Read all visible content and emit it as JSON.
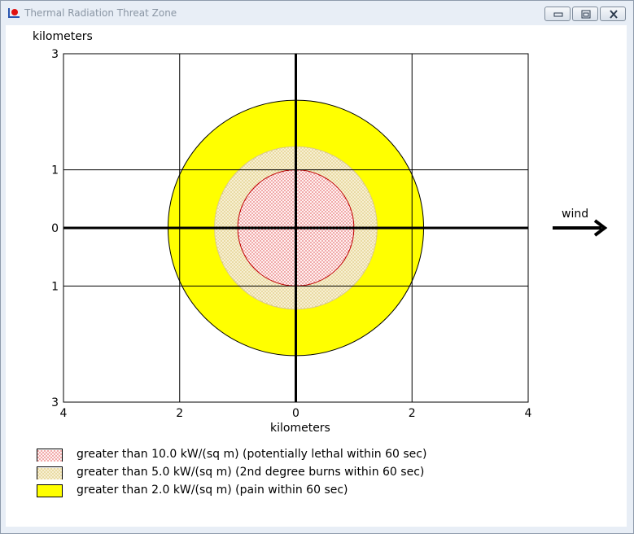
{
  "window": {
    "title": "Thermal Radiation Threat Zone",
    "minimize_icon": "minimize-icon",
    "maximize_icon": "restore-icon",
    "close_icon": "close-icon"
  },
  "wind": {
    "label": "wind",
    "icon": "arrow-right-icon"
  },
  "colors": {
    "lethal": "#fff0f0",
    "lethal_dots": "#cc0000",
    "lethal_edge": "#c00000",
    "burns": "#f5edd0",
    "burns_dots": "#c8a830",
    "pain": "#ffff00"
  },
  "legend": [
    {
      "label": "greater than 10.0 kW/(sq m) (potentially lethal within 60 sec)",
      "swatch": "lethal"
    },
    {
      "label": "greater than 5.0 kW/(sq m) (2nd degree burns within 60 sec)",
      "swatch": "burns"
    },
    {
      "label": "greater than 2.0 kW/(sq m) (pain within 60 sec)",
      "swatch": "pain"
    }
  ],
  "chart_data": {
    "type": "area",
    "xlabel": "kilometers",
    "ylabel": "kilometers",
    "xlim": [
      -4,
      4
    ],
    "ylim": [
      -3,
      3
    ],
    "x_ticks": [
      -4,
      -2,
      0,
      2,
      4
    ],
    "x_tick_labels": [
      "4",
      "2",
      "0",
      "2",
      "4"
    ],
    "y_ticks": [
      3,
      1,
      0,
      -1,
      -3
    ],
    "y_tick_labels": [
      "3",
      "1",
      "0",
      "1",
      "3"
    ],
    "grid": true,
    "zones": [
      {
        "name": "greater than 2.0 kW/(sq m) (pain within 60 sec)",
        "center": [
          0,
          0
        ],
        "radius": 2.2,
        "fill": "pain"
      },
      {
        "name": "greater than 5.0 kW/(sq m) (2nd degree burns within 60 sec)",
        "center": [
          0,
          0
        ],
        "radius": 1.4,
        "fill": "burns"
      },
      {
        "name": "greater than 10.0 kW/(sq m) (potentially lethal within 60 sec)",
        "center": [
          0,
          0
        ],
        "radius": 1.0,
        "fill": "lethal"
      }
    ]
  }
}
